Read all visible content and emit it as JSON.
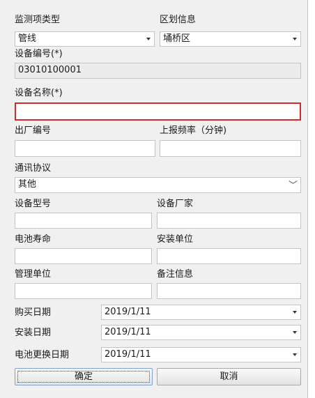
{
  "form": {
    "monitor_type": {
      "label": "监测项类型",
      "value": "管线"
    },
    "region": {
      "label": "区划信息",
      "value": "埇桥区"
    },
    "device_no": {
      "label": "设备编号(*)",
      "value": "03010100001"
    },
    "device_name": {
      "label": "设备名称(*)",
      "value": ""
    },
    "factory_no": {
      "label": "出厂编号",
      "value": ""
    },
    "report_freq": {
      "label": "上报频率（分钟)",
      "value": ""
    },
    "protocol": {
      "label": "通讯协议",
      "value": "其他"
    },
    "device_model": {
      "label": "设备型号",
      "value": ""
    },
    "manufacturer": {
      "label": "设备厂家",
      "value": ""
    },
    "battery_life": {
      "label": "电池寿命",
      "value": ""
    },
    "install_unit": {
      "label": "安装单位",
      "value": ""
    },
    "manage_unit": {
      "label": "管理单位",
      "value": ""
    },
    "remark": {
      "label": "备注信息",
      "value": ""
    },
    "purchase_date": {
      "label": "购买日期",
      "value": "2019/1/11"
    },
    "install_date": {
      "label": "安装日期",
      "value": "2019/1/11"
    },
    "battery_date": {
      "label": "电池更换日期",
      "value": "2019/1/11"
    }
  },
  "buttons": {
    "ok": "确定",
    "cancel": "取消"
  },
  "colors": {
    "background": "#f0f0f0",
    "error_border": "#d32b2b",
    "input_border": "#c4c4c4"
  }
}
